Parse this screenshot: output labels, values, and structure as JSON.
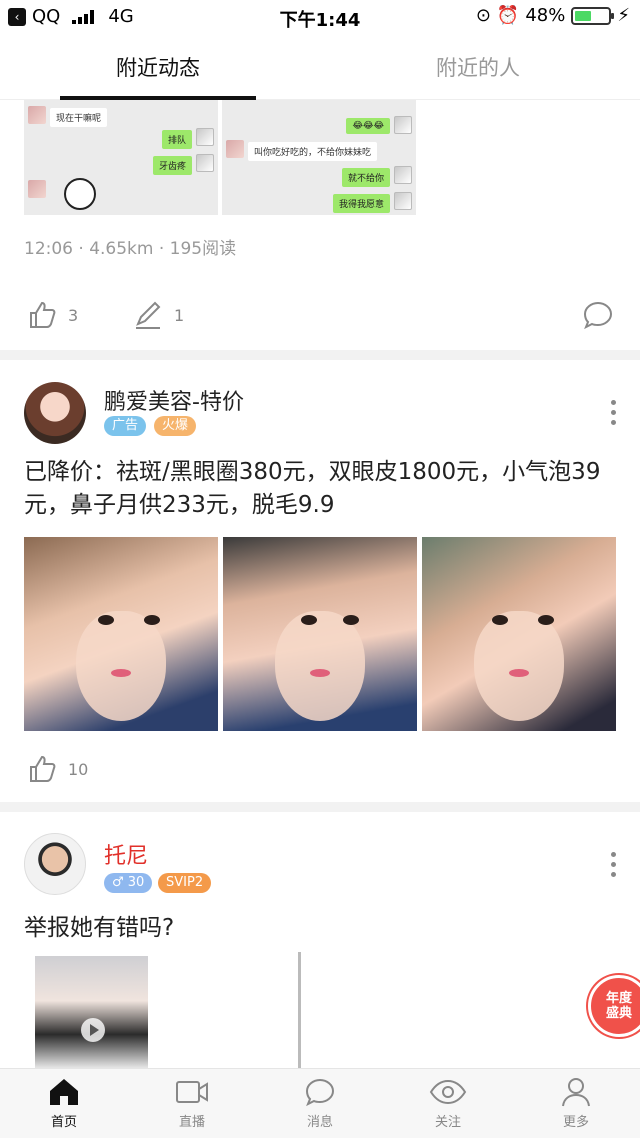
{
  "status_bar": {
    "carrier": "QQ",
    "network": "4G",
    "time": "下午1:44",
    "battery": "48%"
  },
  "tabs": [
    {
      "label": "附近动态"
    },
    {
      "label": "附近的人"
    }
  ],
  "post1": {
    "chat_left": {
      "msg1": "现在干嘛呢",
      "msg2": "排队",
      "msg3": "牙齿疼"
    },
    "chat_right": {
      "msg1": "😂😂😂",
      "msg2": "叫你吃好吃的，不给你妹妹吃",
      "msg3": "就不给你",
      "msg4": "我得我愿意"
    },
    "meta": "12:06 · 4.65km · 195阅读",
    "likes": "3",
    "comments": "1"
  },
  "post2": {
    "author": "鹏爱美容-特价",
    "tags": [
      "广告",
      "火爆"
    ],
    "text": "已降价：祛斑/黑眼圈380元，双眼皮1800元，小气泡39元，鼻子月供233元，脱毛9.9",
    "likes": "10"
  },
  "post3": {
    "author": "托尼",
    "gender_age": "♂ 30",
    "vip": "SVIP2",
    "text": "举报她有错吗?"
  },
  "float_badge": "年度\n盛典",
  "bottom_nav": [
    {
      "label": "首页",
      "icon": "home-icon"
    },
    {
      "label": "直播",
      "icon": "video-camera-icon"
    },
    {
      "label": "消息",
      "icon": "chat-bubble-icon"
    },
    {
      "label": "关注",
      "icon": "eye-icon"
    },
    {
      "label": "更多",
      "icon": "person-icon"
    }
  ],
  "colors": {
    "accent_red": "#e1302a",
    "tag_blue": "#7bc3ec",
    "tag_orange": "#f6b46c",
    "svip_orange": "#f49a4a",
    "battery_green": "#4cd964"
  }
}
